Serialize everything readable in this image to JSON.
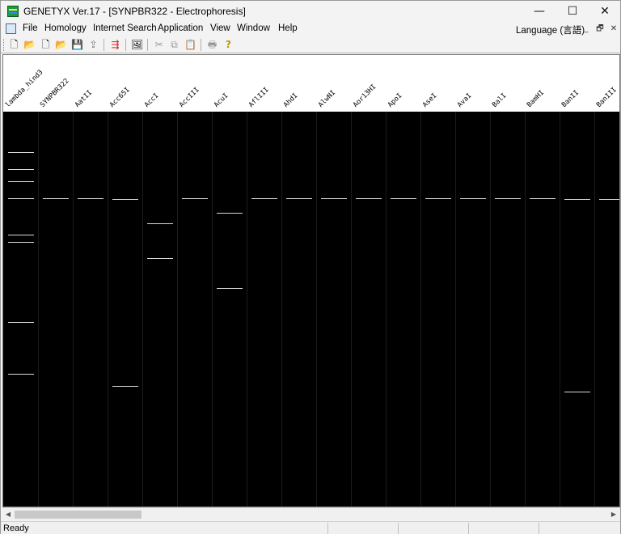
{
  "window": {
    "title": "GENETYX Ver.17 - [SYNPBR322 - Electrophoresis]",
    "minimize_glyph": "—",
    "maximize_glyph": "☐",
    "close_glyph": "✕"
  },
  "menubar": {
    "items": [
      "File",
      "Homology",
      "Internet Search",
      "Application",
      "View",
      "Window",
      "Help"
    ],
    "language": "Language (言語)",
    "mdi_minimize": "_",
    "mdi_restore": "🗗",
    "mdi_close": "✕"
  },
  "toolbar": {
    "buttons": [
      {
        "name": "new-document-icon",
        "glyph": "🗋"
      },
      {
        "name": "open-folder-icon",
        "glyph": "📂"
      },
      {
        "name": "new-file-icon",
        "glyph": "🗋"
      },
      {
        "name": "open-file-icon",
        "glyph": "📂"
      },
      {
        "name": "save-icon",
        "glyph": "💾"
      },
      {
        "name": "export-icon",
        "glyph": "⇪"
      },
      {
        "name": "sort-lanes-icon",
        "glyph": "⇶"
      },
      {
        "name": "image-icon",
        "glyph": "🖼"
      },
      {
        "name": "cut-icon",
        "glyph": "✂"
      },
      {
        "name": "copy-icon",
        "glyph": "⧉"
      },
      {
        "name": "paste-icon",
        "glyph": "📋"
      },
      {
        "name": "print-icon",
        "glyph": "🖶"
      },
      {
        "name": "help-icon",
        "glyph": "?"
      }
    ],
    "colors": {
      "sort_icon": "#e02020",
      "help_icon": "#d4b000"
    }
  },
  "gel": {
    "lanes": [
      "lambda_hind3",
      "SYNPBR322",
      "AatII",
      "Acc65I",
      "AccI",
      "AccIII",
      "AcuI",
      "AflIII",
      "AhdI",
      "AlwNI",
      "Aor13HI",
      "ApoI",
      "AseI",
      "AvaI",
      "BalI",
      "BamHI",
      "BanII",
      "BanIII"
    ],
    "band_color": "#d8d8d8",
    "background_color": "#000000"
  },
  "statusbar": {
    "text": "Ready"
  }
}
